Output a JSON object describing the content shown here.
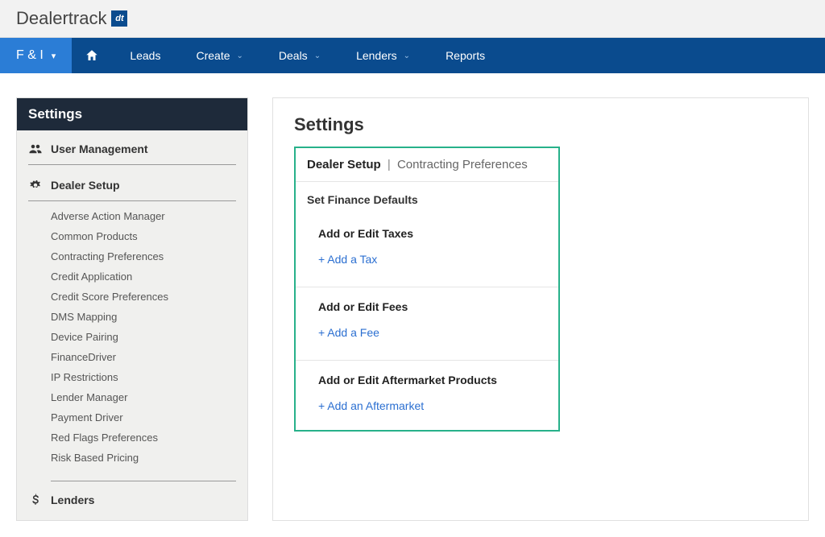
{
  "header": {
    "logo_text": "Dealertrack",
    "badge": "dt"
  },
  "nav": {
    "brand": "F & I",
    "items": [
      {
        "label": "Leads",
        "has_chev": false
      },
      {
        "label": "Create",
        "has_chev": true
      },
      {
        "label": "Deals",
        "has_chev": true
      },
      {
        "label": "Lenders",
        "has_chev": true
      },
      {
        "label": "Reports",
        "has_chev": false
      }
    ]
  },
  "sidebar": {
    "title": "Settings",
    "sections": [
      {
        "heading": "User Management",
        "icon": "users",
        "items": []
      },
      {
        "heading": "Dealer Setup",
        "icon": "gears",
        "items": [
          "Adverse Action Manager",
          "Common Products",
          "Contracting Preferences",
          "Credit Application",
          "Credit Score Preferences",
          "DMS Mapping",
          "Device Pairing",
          "FinanceDriver",
          "IP Restrictions",
          "Lender Manager",
          "Payment Driver",
          "Red Flags Preferences",
          "Risk Based Pricing"
        ]
      },
      {
        "heading": "Lenders",
        "icon": "dollar",
        "items": []
      }
    ]
  },
  "content": {
    "title": "Settings",
    "crumb_main": "Dealer Setup",
    "crumb_sub": "Contracting Preferences",
    "subheading": "Set Finance Defaults",
    "blocks": [
      {
        "title": "Add or Edit Taxes",
        "link": "+ Add a Tax"
      },
      {
        "title": "Add or Edit Fees",
        "link": "+ Add a Fee"
      },
      {
        "title": "Add or Edit Aftermarket Products",
        "link": "+ Add an Aftermarket"
      }
    ]
  }
}
